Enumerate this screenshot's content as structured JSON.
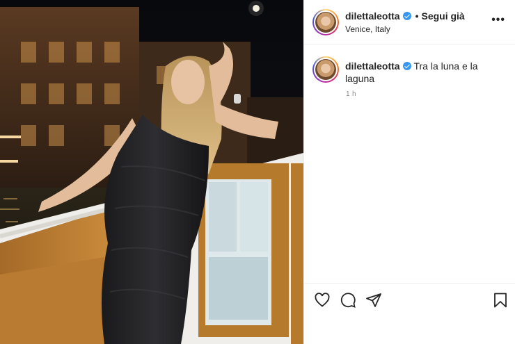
{
  "post": {
    "username": "dilettaleotta",
    "follow_label": "Segui già",
    "location": "Venice, Italy",
    "more_label": "•••",
    "caption": "Tra la luna e la laguna",
    "time": "1 h"
  },
  "icons": [
    "more-options-icon",
    "verified-badge-icon",
    "like-heart-icon",
    "comment-icon",
    "share-plane-icon",
    "save-bookmark-icon"
  ],
  "colors": {
    "verified": "#3897f0",
    "muted": "#8e8e8e",
    "text": "#262626"
  }
}
